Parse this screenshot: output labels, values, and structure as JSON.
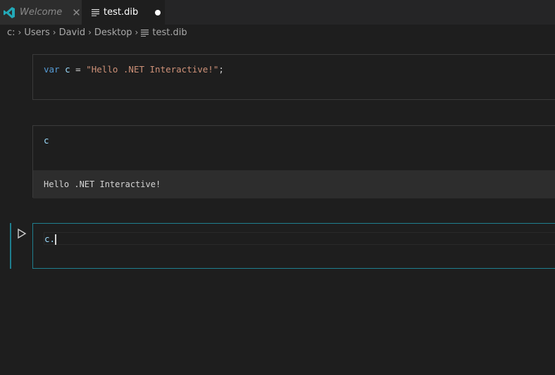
{
  "tabs": [
    {
      "label": "Welcome",
      "close": "✕",
      "icon": "vscode-icon"
    },
    {
      "label": "test.dib",
      "dirty": "●",
      "icon": "file-lines-icon"
    }
  ],
  "breadcrumb": {
    "items": [
      "c:",
      "Users",
      "David",
      "Desktop",
      "test.dib"
    ],
    "separator": "›"
  },
  "cells": [
    {
      "code": {
        "kw": "var",
        "ident": "c",
        "op": " = ",
        "str": "\"Hello .NET Interactive!\"",
        "end": ";"
      }
    },
    {
      "code": "c",
      "output": "Hello .NET Interactive!"
    },
    {
      "code": "c."
    }
  ],
  "colors": {
    "accent": "#1f7f8f",
    "keyword": "#569cd6",
    "string": "#ce9178",
    "identifier": "#9cdcfe"
  }
}
